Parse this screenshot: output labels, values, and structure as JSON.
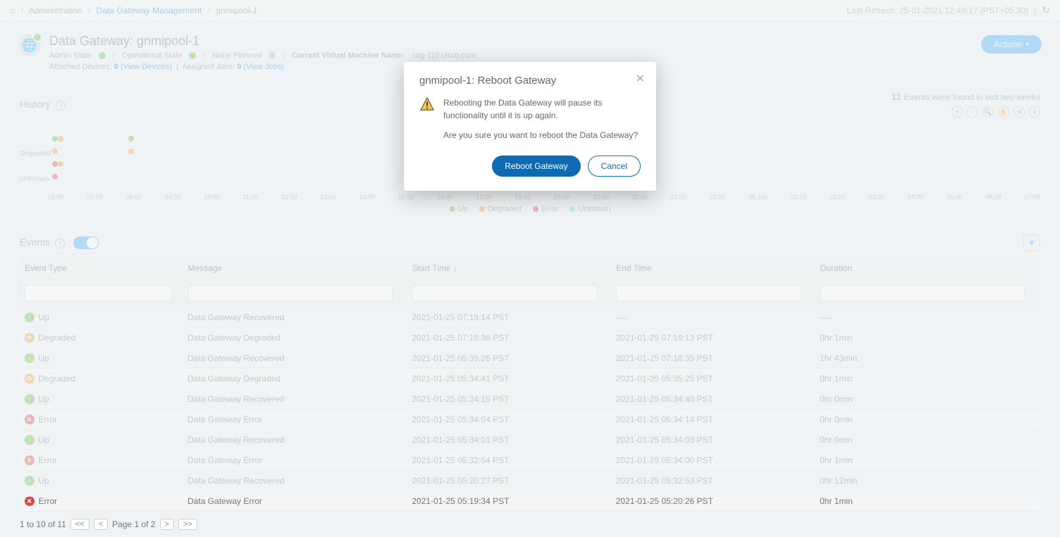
{
  "breadcrumb": {
    "admin": "Administration",
    "mgmt": "Data Gateway Management",
    "current": "gnmipool-1"
  },
  "refresh": {
    "label": "Last Refresh: 25-01-2021 12:49:17 (PST+05.30)"
  },
  "header": {
    "title": "Data Gateway: gnmipool-1",
    "admin_state_label": "Admin State",
    "op_state_label": "Operational State",
    "planned_label": "None Planned",
    "vm_label": "Current Virtual Machine Name:",
    "vm_value": "cdg-110.cisco.com",
    "attached_devices_label": "Attached Devices:",
    "attached_devices_count": "0",
    "view_devices": "(View Devices)",
    "assigned_jobs_label": "Assigned Jobs:",
    "assigned_jobs_count": "0",
    "view_jobs": "(View Jobs)",
    "actions_btn": "Actions"
  },
  "history": {
    "title": "History",
    "events_count": "11",
    "events_found_text": "Events were found in last two weeks",
    "y_labels": [
      "",
      "Degraded",
      "",
      "Unknown"
    ],
    "x_labels": [
      "06:00",
      "07:00",
      "08:00",
      "09:00",
      "10:00",
      "11:00",
      "12:00",
      "13:00",
      "14:00",
      "15:00",
      "16:00",
      "17:00",
      "18:00",
      "19:00",
      "20:00",
      "21:00",
      "22:00",
      "23:00",
      "26 Jan",
      "01:00",
      "02:00",
      "03:00",
      "04:00",
      "05:00",
      "06:00",
      "07:00"
    ],
    "legend": {
      "up": "Up",
      "degraded": "Degraded",
      "error": "Error",
      "unknown": "Unknown"
    }
  },
  "events": {
    "title": "Events",
    "cols": {
      "type": "Event Type",
      "msg": "Message",
      "start": "Start Time",
      "end": "End Time",
      "dur": "Duration"
    },
    "sort_indicator": "↓",
    "rows": [
      {
        "type": "Up",
        "icon": "up",
        "msg": "Data Gateway Recovered",
        "start": "2021-01-25 07:19:14 PST",
        "end": "----",
        "dur": "----"
      },
      {
        "type": "Degraded",
        "icon": "deg",
        "msg": "Data Gateway Degraded",
        "start": "2021-01-25 07:18:36 PST",
        "end": "2021-01-25 07:19:13 PST",
        "dur": "0hr 1min"
      },
      {
        "type": "Up",
        "icon": "up",
        "msg": "Data Gateway Recovered",
        "start": "2021-01-25 05:35:26 PST",
        "end": "2021-01-25 07:18:35 PST",
        "dur": "1hr 43min"
      },
      {
        "type": "Degraded",
        "icon": "deg",
        "msg": "Data Gateway Degraded",
        "start": "2021-01-25 05:34:41 PST",
        "end": "2021-01-25 05:35:25 PST",
        "dur": "0hr 1min"
      },
      {
        "type": "Up",
        "icon": "up",
        "msg": "Data Gateway Recovered",
        "start": "2021-01-25 05:34:15 PST",
        "end": "2021-01-25 05:34:40 PST",
        "dur": "0hr 0min"
      },
      {
        "type": "Error",
        "icon": "err",
        "msg": "Data Gateway Error",
        "start": "2021-01-25 05:34:04 PST",
        "end": "2021-01-25 05:34:14 PST",
        "dur": "0hr 0min"
      },
      {
        "type": "Up",
        "icon": "up",
        "msg": "Data Gateway Recovered",
        "start": "2021-01-25 05:34:01 PST",
        "end": "2021-01-25 05:34:03 PST",
        "dur": "0hr 0min"
      },
      {
        "type": "Error",
        "icon": "err",
        "msg": "Data Gateway Error",
        "start": "2021-01-25 05:32:54 PST",
        "end": "2021-01-25 05:34:00 PST",
        "dur": "0hr 1min"
      },
      {
        "type": "Up",
        "icon": "up",
        "msg": "Data Gateway Recovered",
        "start": "2021-01-25 05:20:27 PST",
        "end": "2021-01-25 05:32:53 PST",
        "dur": "0hr 12min"
      },
      {
        "type": "Error",
        "icon": "err",
        "msg": "Data Gateway Error",
        "start": "2021-01-25 05:19:34 PST",
        "end": "2021-01-25 05:20:26 PST",
        "dur": "0hr 1min"
      }
    ],
    "pager": {
      "range": "1 to 10 of 11",
      "page": "Page 1 of 2"
    }
  },
  "modal": {
    "title": "gnmipool-1: Reboot Gateway",
    "warn": "Rebooting the Data Gateway will pause its functionality until it is up again.",
    "question": "Are you sure you want to reboot the Data Gateway?",
    "primary": "Reboot Gateway",
    "secondary": "Cancel"
  },
  "chart_data": {
    "type": "scatter",
    "title": "History",
    "series_colors": {
      "Up": "#6cc04a",
      "Degraded": "#e8a33d",
      "Error": "#d94b4b",
      "Unknown": "#7fd3e6"
    },
    "y_categories": [
      "Up",
      "Degraded",
      "Error",
      "Unknown"
    ],
    "x_range": [
      "25 Jan 06:00",
      "26 Jan 08:00"
    ],
    "points": [
      {
        "x": "06:00",
        "y": "Up",
        "status": "Up"
      },
      {
        "x": "06:05",
        "y": "Up",
        "status": "Degraded"
      },
      {
        "x": "08:00",
        "y": "Up",
        "status": "Up"
      },
      {
        "x": "06:00",
        "y": "Degraded",
        "status": "Degraded"
      },
      {
        "x": "08:00",
        "y": "Degraded",
        "status": "Degraded"
      },
      {
        "x": "06:00",
        "y": "Error",
        "status": "Error"
      },
      {
        "x": "06:05",
        "y": "Error",
        "status": "Degraded"
      },
      {
        "x": "06:00",
        "y": "Unknown",
        "status": "Error"
      }
    ]
  }
}
